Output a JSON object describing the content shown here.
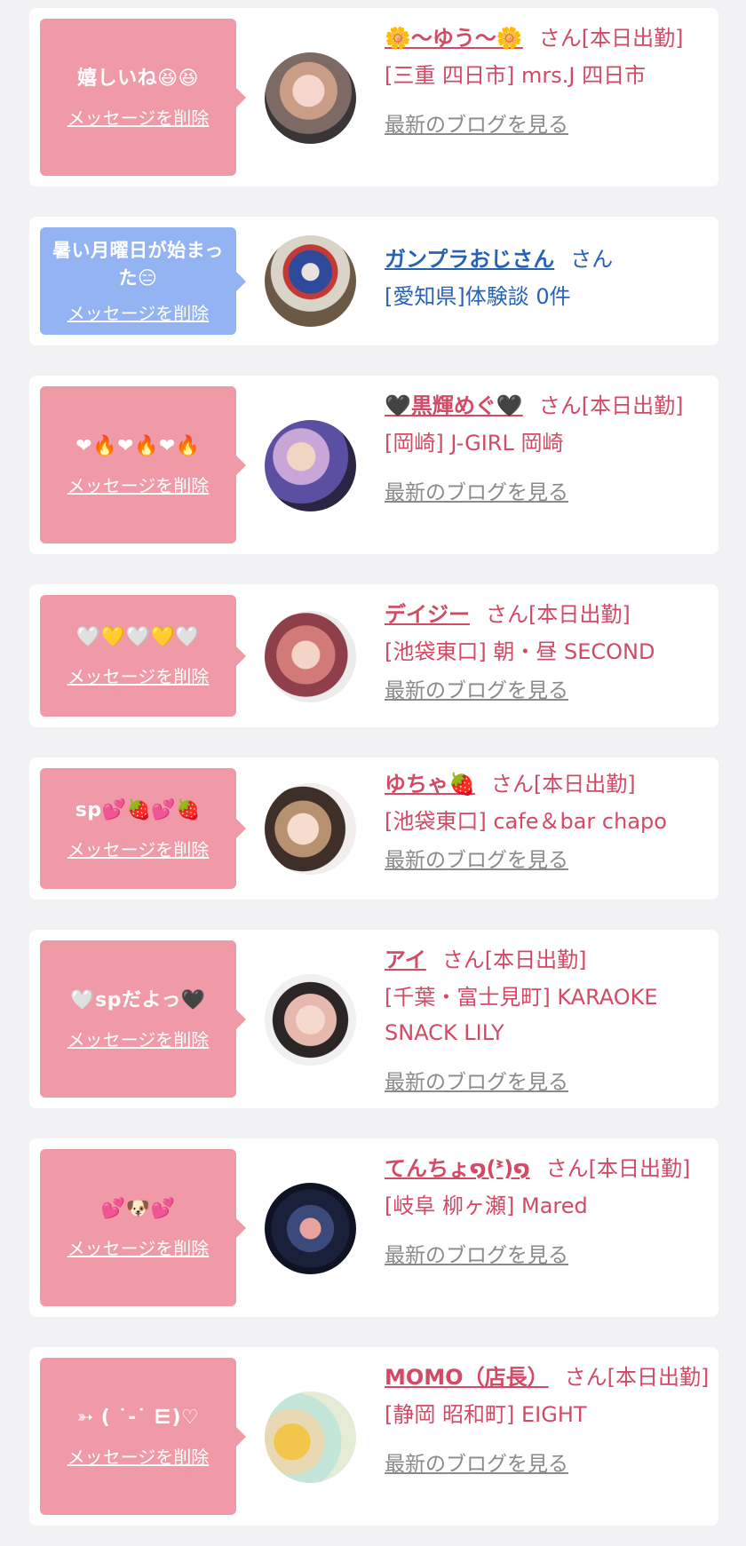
{
  "delete_label": "メッセージを削除",
  "blog_label": "最新のブログを見る",
  "san_suffix": "さん",
  "cards": [
    {
      "message": "嬉しいね😆😆",
      "name": "🌼〜ゆう〜🌼",
      "tail": "さん[本日出勤]",
      "location": "[三重 四日市] mrs.J 四日市",
      "has_blog": true,
      "theme": "pink"
    },
    {
      "message": "暑い月曜日が始まった😑",
      "name": "ガンプラおじさん",
      "tail": "さん",
      "location": "[愛知県]体験談 0件",
      "has_blog": false,
      "theme": "blue"
    },
    {
      "message": "❤🔥❤🔥❤🔥",
      "name": "🖤黒輝めぐ🖤",
      "tail": "さん[本日出勤]",
      "location": "[岡崎] J-GIRL 岡崎",
      "has_blog": true,
      "theme": "pink"
    },
    {
      "message": "🤍💛🤍💛🤍",
      "name": "デイジー",
      "tail": "さん[本日出勤]",
      "location": "[池袋東口] 朝・昼 SECOND",
      "has_blog": true,
      "theme": "pink"
    },
    {
      "message": "sp💕🍓💕🍓",
      "name": "ゆちゃ🍓",
      "tail": "さん[本日出勤]",
      "location": "[池袋東口] cafe＆bar chapo",
      "has_blog": true,
      "theme": "pink"
    },
    {
      "message": "🤍spだよっ🖤",
      "name": "アイ",
      "tail": "さん[本日出勤]",
      "location": "[千葉・富士見町] KARAOKE SNACK LILY",
      "has_blog": true,
      "theme": "pink"
    },
    {
      "message": "💕🐶💕",
      "name": "てんちょ໑(ᕑ)໑",
      "tail": "さん[本日出勤]",
      "location": "[岐阜 柳ヶ瀬] Mared",
      "has_blog": true,
      "theme": "pink"
    },
    {
      "message": "➳ ( ˙-˙ ⋿)♡",
      "name": "MOMO（店長）",
      "tail": "さん[本日出勤]",
      "location": "[静岡 昭和町] EIGHT",
      "has_blog": true,
      "theme": "pink"
    }
  ]
}
